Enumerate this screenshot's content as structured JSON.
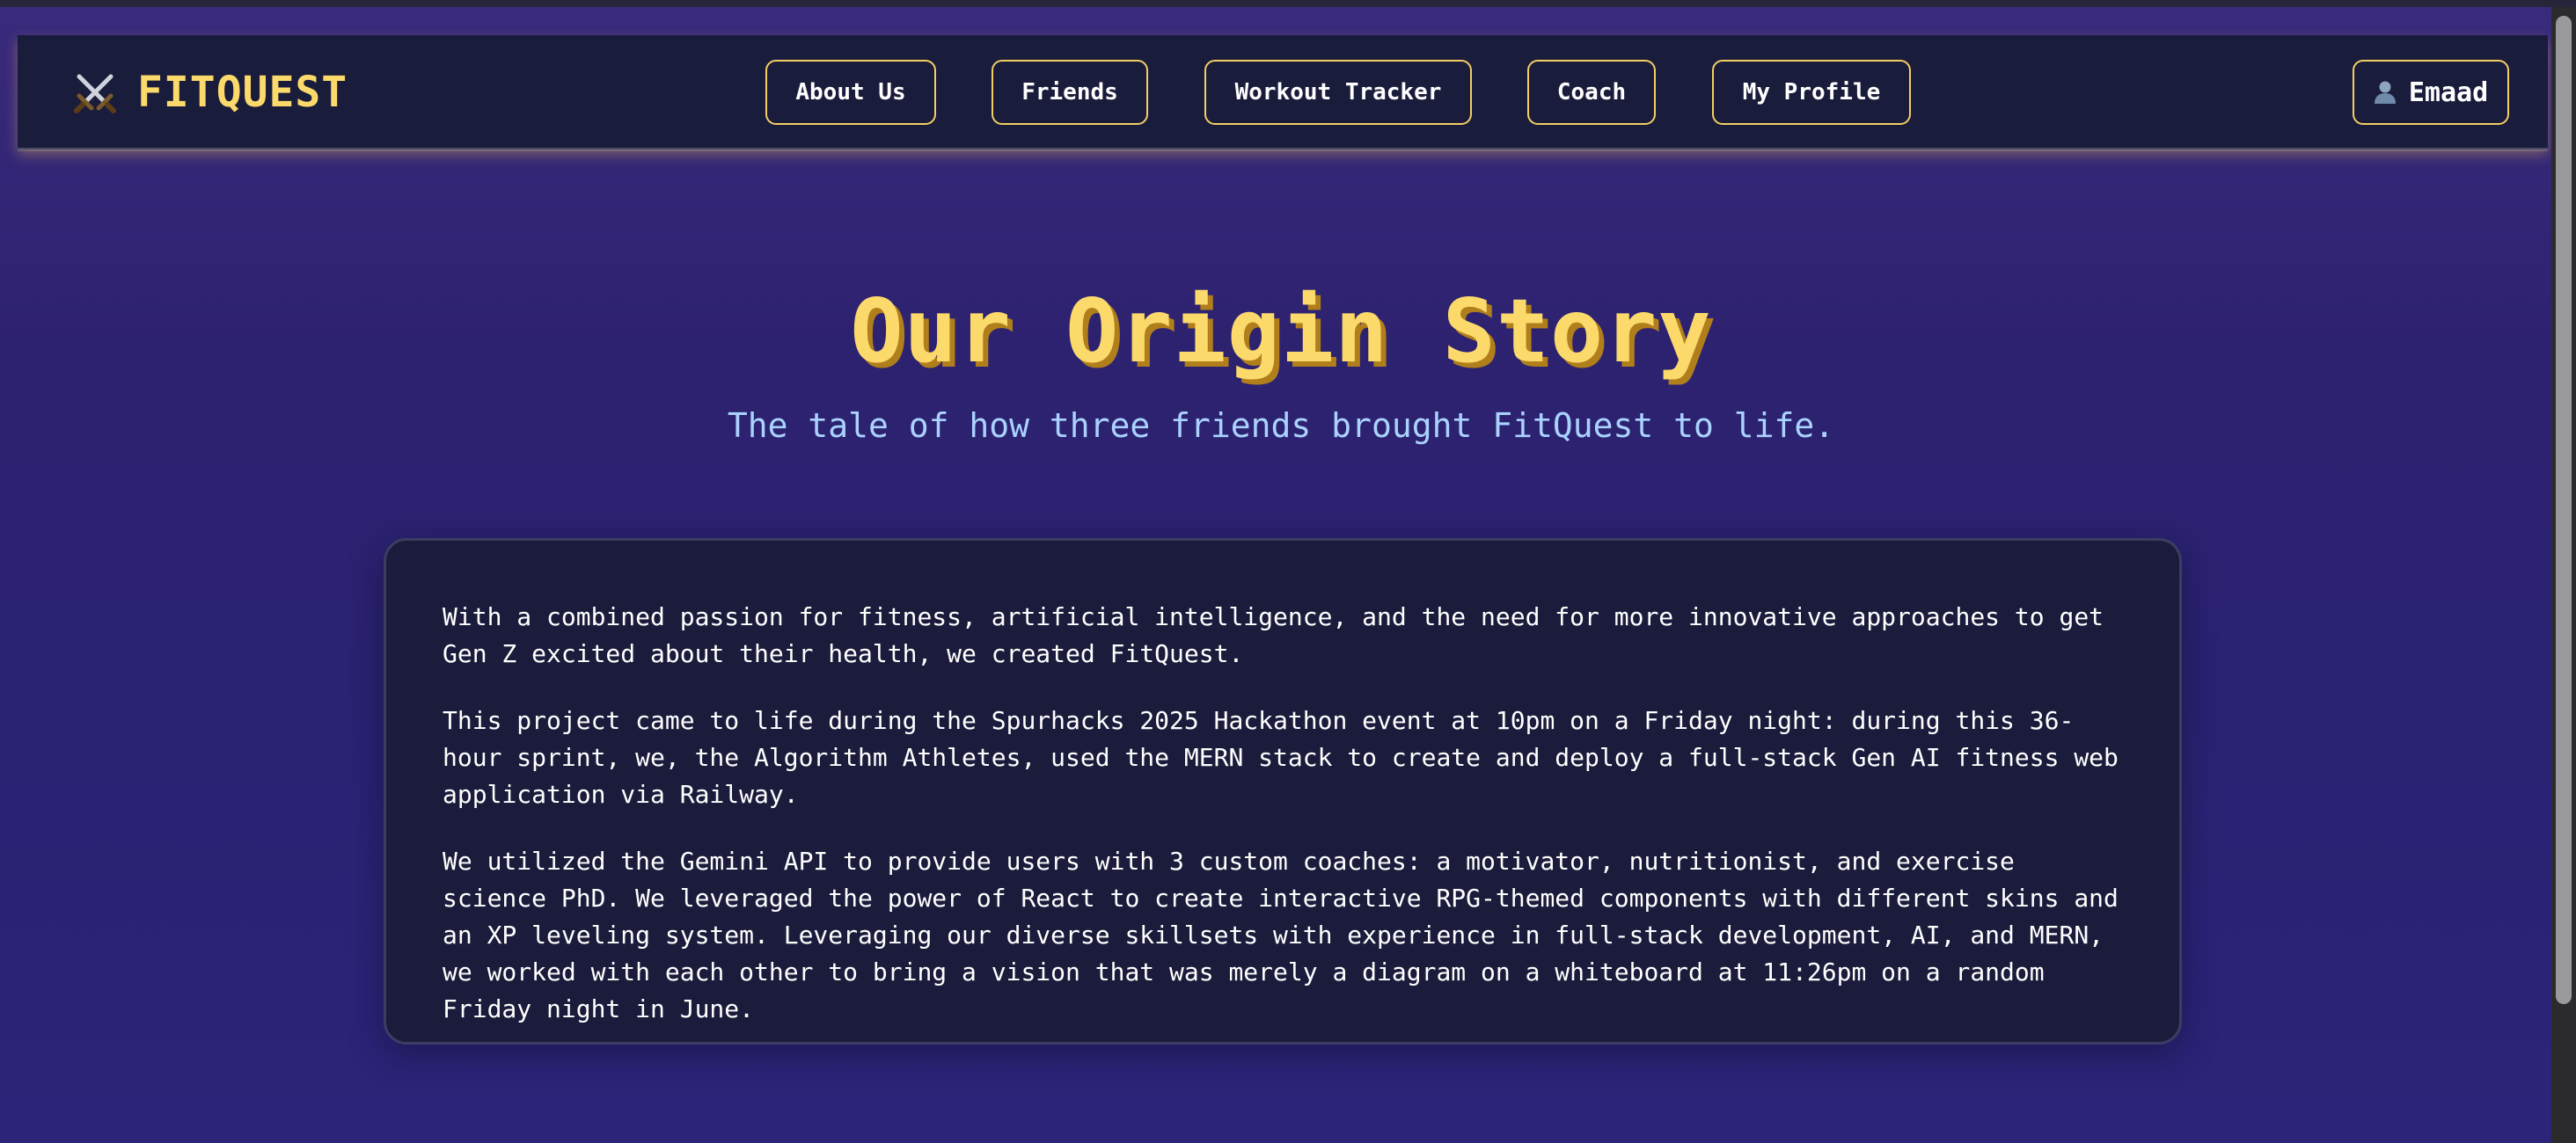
{
  "header": {
    "brand_icon": "crossed-swords-icon",
    "brand_name": "FITQUEST",
    "nav": [
      {
        "label": "About Us"
      },
      {
        "label": "Friends"
      },
      {
        "label": "Workout Tracker"
      },
      {
        "label": "Coach"
      },
      {
        "label": "My Profile"
      }
    ],
    "user": {
      "icon": "user-silhouette-icon",
      "name": "Emaad"
    }
  },
  "main": {
    "title": "Our Origin Story",
    "subtitle": "The tale of how three friends brought FitQuest to life.",
    "paragraphs": [
      "With a combined passion for fitness, artificial intelligence, and the need for more innovative approaches to get Gen Z excited about their health, we created FitQuest.",
      "This project came to life during the Spurhacks 2025 Hackathon event at 10pm on a Friday night: during this 36-hour sprint, we, the Algorithm Athletes, used the MERN stack to create and deploy a full-stack Gen AI fitness web application via Railway.",
      "We utilized the Gemini API to provide users with 3 custom coaches: a motivator, nutritionist, and exercise science PhD. We leveraged the power of React to create interactive RPG-themed components with different skins and an XP leveling system. Leveraging our diverse skillsets with experience in full-stack development, AI, and MERN, we worked with each other to bring a vision that was merely a diagram on a whiteboard at 11:26pm on a random Friday night in June."
    ]
  },
  "colors": {
    "background": "#2d2270",
    "navbar": "#1a1c3c",
    "accent_gold": "#fbd96a",
    "subtitle_blue": "#aad2ff",
    "card": "#1b1c3c"
  }
}
